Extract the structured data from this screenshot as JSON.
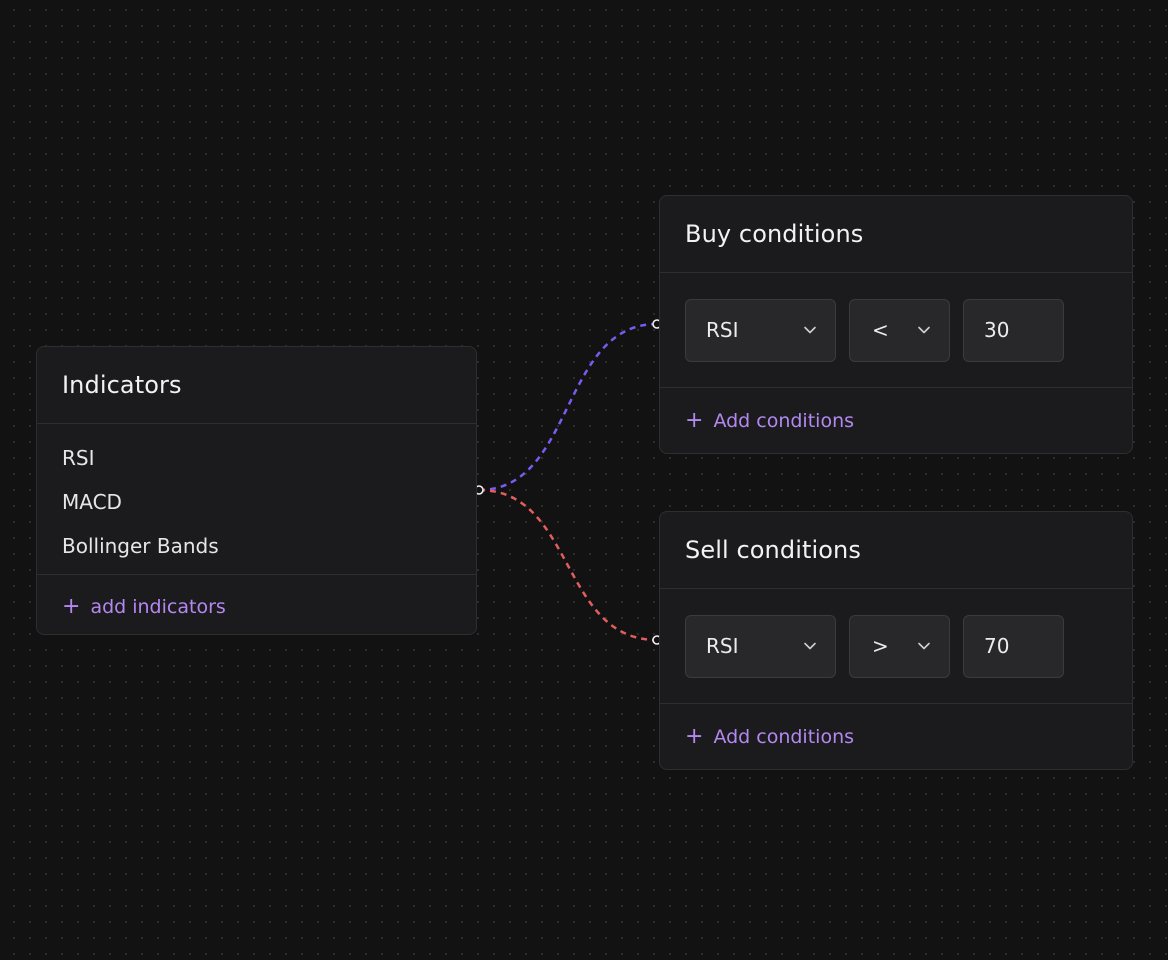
{
  "indicators": {
    "title": "Indicators",
    "items": [
      "RSI",
      "MACD",
      "Bollinger Bands"
    ],
    "add_label": "add indicators"
  },
  "buy": {
    "title": "Buy conditions",
    "indicator": "RSI",
    "operator": "<",
    "value": "30",
    "add_label": "Add conditions",
    "link_color": "#7a5af0"
  },
  "sell": {
    "title": "Sell conditions",
    "indicator": "RSI",
    "operator": ">",
    "value": "70",
    "add_label": "Add conditions",
    "link_color": "#e25d5d"
  },
  "accent_color": "#b388f0",
  "icons": {
    "add": "plus-icon",
    "dropdown": "chevron-down-icon",
    "port": "connection-port-icon"
  }
}
